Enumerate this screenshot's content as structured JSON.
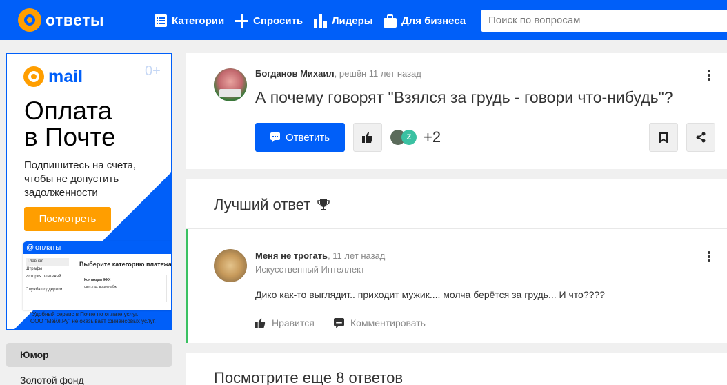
{
  "header": {
    "logo_text": "ответы",
    "nav": [
      {
        "label": "Категории",
        "icon": "list-icon"
      },
      {
        "label": "Спросить",
        "icon": "plus-icon"
      },
      {
        "label": "Лидеры",
        "icon": "bars-icon"
      },
      {
        "label": "Для бизнеса",
        "icon": "briefcase-icon"
      }
    ],
    "search_placeholder": "Поиск по вопросам"
  },
  "ad": {
    "brand": "mail",
    "age": "0+",
    "title_line1": "Оплата",
    "title_line2": "в Почте",
    "subtitle": "Подпишитесь на счета, чтобы не допустить задолженности",
    "button": "Посмотреть",
    "shot": {
      "header": "оплаты",
      "menu": [
        "Главная",
        "Штрафы",
        "История платежей",
        "Служба поддержки"
      ],
      "heading": "Выберите категорию платежа",
      "card_title": "Контакции ЖКХ",
      "card_sub": "свет, газ, водоснабж."
    },
    "footer_line1": "\"Удобный сервис в Почте по оплате услуг.",
    "footer_line2": "ООО \"Мэйл.Ру\" не оказывает финансовых услуг."
  },
  "sidebar": {
    "items": [
      "Юмор",
      "Золотой фонд"
    ]
  },
  "question": {
    "author": "Богданов Михаил",
    "meta": ", решён 11 лет назад",
    "title": "А почему говорят \"Взялся за грудь - говори что-нибудь\"?",
    "answer_button": "Ответить",
    "mini_avatar_letter": "Z",
    "extra_count": "+2"
  },
  "best_answer": {
    "heading": "Лучший ответ",
    "author": "Меня не трогать",
    "time": ", 11 лет назад",
    "rank": "Искусственный Интеллект",
    "text": "Дико как-то выглядит.. приходит мужик.... молча берётся за грудь... И что????",
    "like": "Нравится",
    "comment": "Комментировать"
  },
  "more": {
    "heading": "Посмотрите еще 8 ответов"
  },
  "colors": {
    "brand_blue": "#005ff9",
    "accent_orange": "#ff9e00",
    "best_answer_green": "#3ac162"
  }
}
